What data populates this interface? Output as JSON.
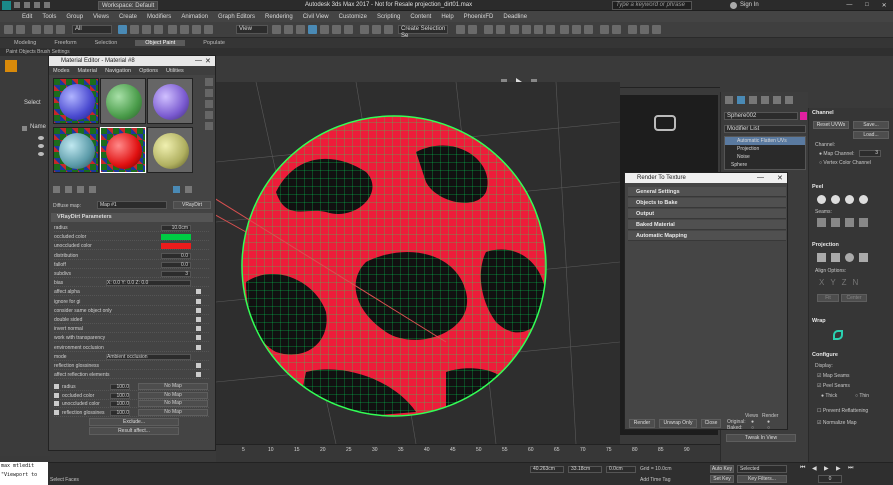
{
  "titlebar": {
    "workspace": "Workspace: Default",
    "title": "Autodesk 3ds Max 2017 - Not for Resale   projection_dirt01.max",
    "search_placeholder": "Type a keyword or phrase",
    "signin": "Sign In"
  },
  "menubar": [
    "Edit",
    "Tools",
    "Group",
    "Views",
    "Create",
    "Modifiers",
    "Animation",
    "Graph Editors",
    "Rendering",
    "Civil View",
    "Customize",
    "Scripting",
    "Content",
    "Help",
    "PhoenixFD",
    "Deadline"
  ],
  "toolbar": {
    "filter": "All",
    "view": "View",
    "create_selection": "Create Selection Se"
  },
  "ribbon": {
    "tabs": [
      "Modeling",
      "Freeform",
      "Selection",
      "Object Paint",
      "Populate"
    ],
    "active": "Object Paint",
    "sub": "Paint Objects    Brush Settings"
  },
  "left_strip": {
    "select": "Select",
    "name_label": "Name"
  },
  "material_editor": {
    "title": "Material Editor - Material #8",
    "menu": [
      "Modes",
      "Material",
      "Navigation",
      "Options",
      "Utilities"
    ],
    "diffuse_label": "Diffuse map:",
    "map_name": "Map #1",
    "map_type": "VRayDirt",
    "rollout_title": "VRayDirt Parameters",
    "params": [
      {
        "label": "radius",
        "value": "10.0cm"
      },
      {
        "label": "occluded color",
        "value": ""
      },
      {
        "label": "unoccluded color",
        "value": ""
      },
      {
        "label": "distribution",
        "value": "0.0"
      },
      {
        "label": "falloff",
        "value": "0.0"
      },
      {
        "label": "subdivs",
        "value": "3"
      },
      {
        "label": "bias",
        "value": "X: 0.0  Y: 0.0  Z: 0.0"
      },
      {
        "label": "affect alpha",
        "value": ""
      },
      {
        "label": "ignore for gi",
        "value": ""
      },
      {
        "label": "consider same object only",
        "value": ""
      },
      {
        "label": "double sided",
        "value": ""
      },
      {
        "label": "invert normal",
        "value": ""
      },
      {
        "label": "work with transparency",
        "value": ""
      },
      {
        "label": "environment occlusion",
        "value": ""
      },
      {
        "label": "mode",
        "value": "Ambient occlusion"
      },
      {
        "label": "reflection glossiness",
        "value": ""
      },
      {
        "label": "affect reflection elements",
        "value": ""
      }
    ],
    "maps": [
      {
        "label": "radius",
        "amount": "100.0",
        "map": "No Map"
      },
      {
        "label": "occluded color",
        "amount": "100.0",
        "map": "No Map"
      },
      {
        "label": "unoccluded color",
        "amount": "100.0",
        "map": "No Map"
      },
      {
        "label": "reflection glossines",
        "amount": "100.0",
        "map": "No Map"
      }
    ],
    "exclude": "Exclude...",
    "result_affect": "Result affect..."
  },
  "cmd_panel": {
    "object_name": "Sphere002",
    "modifier_list": "Modifier List",
    "stack": [
      "Automatic Flatten UVs",
      "Projection",
      "Noise",
      "Sphere"
    ]
  },
  "uvw_panel": {
    "channel_title": "Channel",
    "reset_uvws": "Reset UVWs",
    "save": "Save...",
    "load": "Load...",
    "channel_label": "Channel:",
    "map_channel": "Map Channel:",
    "map_channel_value": "3",
    "vertex_color": "Vertex Color Channel",
    "peel_title": "Peel",
    "seams_label": "Seams:",
    "projection_title": "Projection",
    "align_options": "Align Options:",
    "fit": "Fit",
    "center": "Center",
    "wrap_title": "Wrap",
    "configure_title": "Configure",
    "display": "Display:",
    "map_seams": "Map Seams",
    "peel_seams": "Peel Seams",
    "thick": "Thick",
    "thin": "Thin",
    "prevent_reflattening": "Prevent Reflattening",
    "normalize_map": "Normalize Map"
  },
  "rtt": {
    "title": "Render To Texture",
    "rows": [
      "General Settings",
      "Objects to Bake",
      "Output",
      "Baked Material",
      "Automatic Mapping"
    ],
    "render_btn": "Render",
    "unwrap_btn": "Unwrap Only",
    "close_btn": "Close",
    "original": "Original:",
    "baked": "Baked:",
    "views": "Views",
    "render": "Render",
    "tweak": "Tweak In View"
  },
  "timeline": {
    "ticks": [
      "5",
      "10",
      "15",
      "20",
      "25",
      "30",
      "35",
      "40",
      "45",
      "50",
      "55",
      "60",
      "65",
      "70",
      "75",
      "80",
      "85",
      "90"
    ]
  },
  "statusbar": {
    "x": "40.263cm",
    "y": "33.18cm",
    "z": "0.0cm",
    "grid": "Grid = 10.0cm",
    "auto_key": "Auto Key",
    "selected": "Selected",
    "set_key": "Set Key",
    "key_filters": "Key Filters...",
    "add_time_tag": "Add Time Tag",
    "select_faces": "Select Faces",
    "frame": "0"
  },
  "maxscript": {
    "line1": "max mtledit",
    "line2": "\"Viewport to"
  }
}
